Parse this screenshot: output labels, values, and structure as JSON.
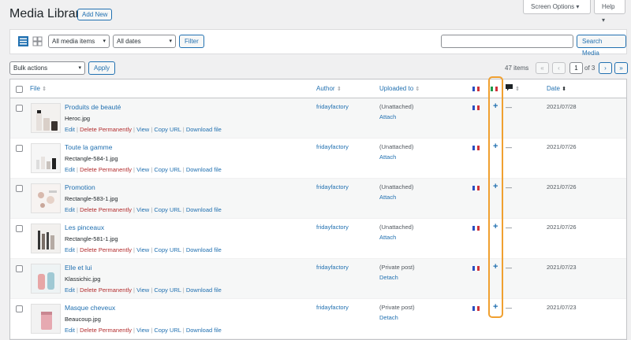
{
  "header": {
    "title": "Media Library",
    "add_new": "Add New",
    "screen_options": "Screen Options ▾",
    "help": "Help ▾"
  },
  "filters": {
    "media_type": "All media items",
    "dates": "All dates",
    "filter_button": "Filter",
    "search_button": "Search Media",
    "search_value": ""
  },
  "bulk": {
    "selected": "Bulk actions",
    "apply": "Apply"
  },
  "pagination": {
    "items_count": "47 items",
    "first": "«",
    "prev": "‹",
    "current": "1",
    "of_total": "of 3",
    "next": "›",
    "last": "»"
  },
  "columns": {
    "file": "File",
    "author": "Author",
    "uploaded_to": "Uploaded to",
    "date": "Date"
  },
  "rows": [
    {
      "title": "Produits de beauté",
      "filename": "Heroc.jpg",
      "author": "fridayfactory",
      "uploaded_to": "(Unattached)",
      "attach": "Attach",
      "date": "2021/07/28"
    },
    {
      "title": "Toute la gamme",
      "filename": "Rectangle-584-1.jpg",
      "author": "fridayfactory",
      "uploaded_to": "(Unattached)",
      "attach": "Attach",
      "date": "2021/07/26"
    },
    {
      "title": "Promotion",
      "filename": "Rectangle-583-1.jpg",
      "author": "fridayfactory",
      "uploaded_to": "(Unattached)",
      "attach": "Attach",
      "date": "2021/07/26"
    },
    {
      "title": "Les pinceaux",
      "filename": "Rectangle-581-1.jpg",
      "author": "fridayfactory",
      "uploaded_to": "(Unattached)",
      "attach": "Attach",
      "date": "2021/07/26"
    },
    {
      "title": "Elle et lui",
      "filename": "Klassichic.jpg",
      "author": "fridayfactory",
      "uploaded_to": "(Private post)",
      "attach": "Detach",
      "date": "2021/07/23"
    },
    {
      "title": "Masque cheveux",
      "filename": "Beaucoup.jpg",
      "author": "fridayfactory",
      "uploaded_to": "(Private post)",
      "attach": "Detach",
      "date": "2021/07/23"
    }
  ],
  "row_actions": {
    "edit": "Edit",
    "delete": "Delete Permanently",
    "view": "View",
    "copy_url": "Copy URL",
    "download": "Download file",
    "separator": "|"
  },
  "add_translation_symbol": "+",
  "no_translation_symbol": "—",
  "colors": {
    "accent": "#2271b1",
    "danger": "#b32d2e",
    "highlight": "#f0a030"
  }
}
